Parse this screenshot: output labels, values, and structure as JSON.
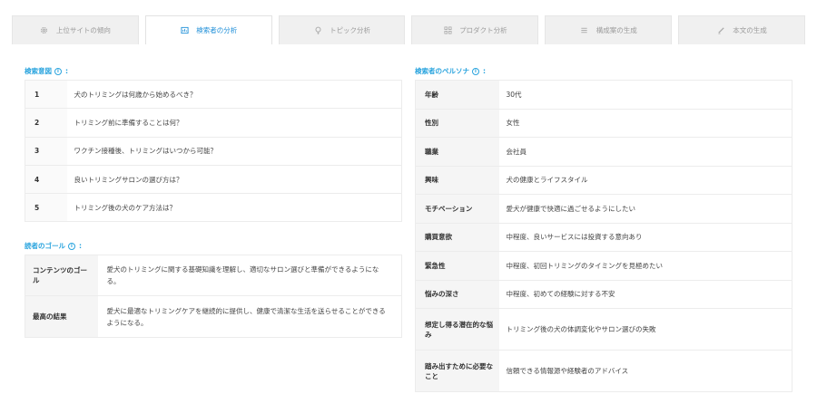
{
  "tabs": [
    {
      "label": "上位サイトの傾向",
      "icon": "gear-icon",
      "active": false
    },
    {
      "label": "検索者の分析",
      "icon": "chart-icon",
      "active": true
    },
    {
      "label": "トピック分析",
      "icon": "lightbulb-icon",
      "active": false
    },
    {
      "label": "プロダクト分析",
      "icon": "grid-icon",
      "active": false
    },
    {
      "label": "構成案の生成",
      "icon": "list-icon",
      "active": false
    },
    {
      "label": "本文の生成",
      "icon": "pencil-icon",
      "active": false
    }
  ],
  "queries": {
    "label": "検索意図",
    "rows": [
      {
        "num": "1",
        "text": "犬のトリミングは何歳から始めるべき？"
      },
      {
        "num": "2",
        "text": "トリミング前に準備することは何？"
      },
      {
        "num": "3",
        "text": "ワクチン接種後、トリミングはいつから可能？"
      },
      {
        "num": "4",
        "text": "良いトリミングサロンの選び方は？"
      },
      {
        "num": "5",
        "text": "トリミング後の犬のケア方法は？"
      }
    ]
  },
  "goal": {
    "label": "読者のゴール",
    "rows": [
      {
        "key": "コンテンツのゴール",
        "value": "愛犬のトリミングに関する基礎知識を理解し、適切なサロン選びと準備ができるようになる。"
      },
      {
        "key": "最高の結果",
        "value": "愛犬に最適なトリミングケアを継続的に提供し、健康で清潔な生活を送らせることができるようになる。"
      }
    ]
  },
  "persona": {
    "label": "検索者のペルソナ",
    "rows": [
      {
        "key": "年齢",
        "value": "30代"
      },
      {
        "key": "性別",
        "value": "女性"
      },
      {
        "key": "職業",
        "value": "会社員"
      },
      {
        "key": "興味",
        "value": "犬の健康とライフスタイル"
      },
      {
        "key": "モチベーション",
        "value": "愛犬が健康で快適に過ごせるようにしたい"
      },
      {
        "key": "購買意欲",
        "value": "中程度、良いサービスには投資する意向あり"
      },
      {
        "key": "緊急性",
        "value": "中程度、初回トリミングのタイミングを見極めたい"
      },
      {
        "key": "悩みの深さ",
        "value": "中程度、初めての経験に対する不安"
      },
      {
        "key": "想定し得る潜在的な悩み",
        "value": "トリミング後の犬の体調変化やサロン選びの失敗"
      },
      {
        "key": "踏み出すために必要なこと",
        "value": "信頼できる情報源や経験者のアドバイス"
      }
    ]
  },
  "colors": {
    "accent": "#2aa4de",
    "active_tab": "#1f8fd8",
    "tab_bg": "#f0f0f0"
  }
}
